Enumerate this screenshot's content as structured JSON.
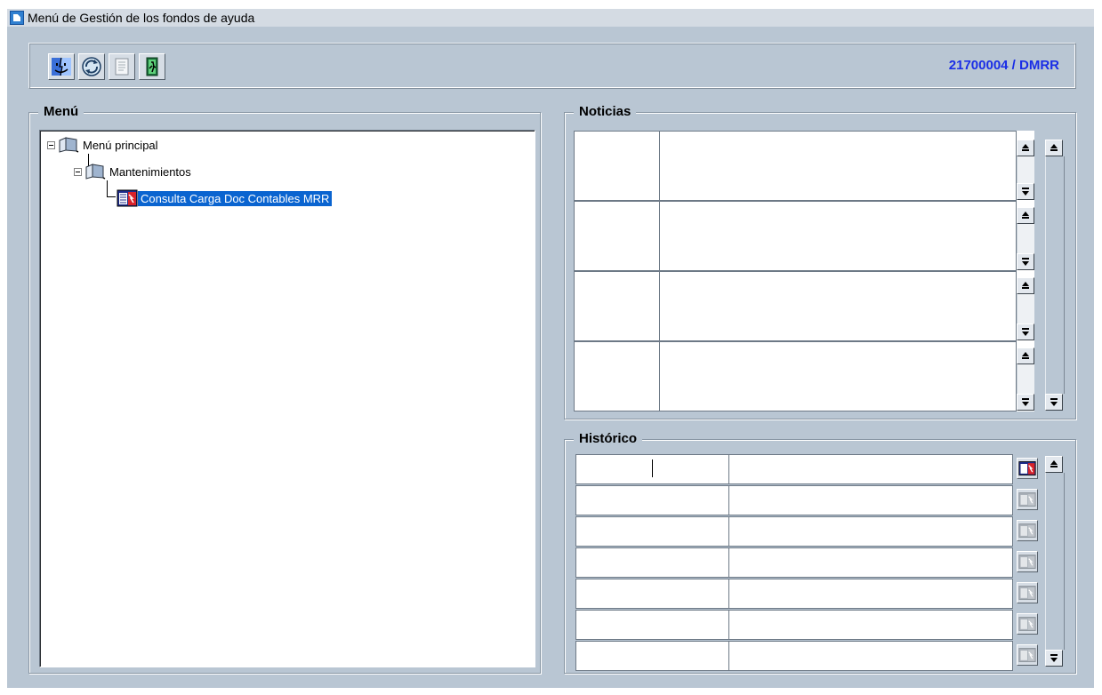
{
  "window": {
    "title": "Menú de Gestión de los fondos de ayuda"
  },
  "toolbar": {
    "buttons": [
      {
        "name": "finder-icon"
      },
      {
        "name": "refresh-icon"
      },
      {
        "name": "document-icon"
      },
      {
        "name": "exit-door-icon"
      }
    ],
    "user": "21700004 / DMRR"
  },
  "menu": {
    "title": "Menú",
    "tree": {
      "root": "Menú principal",
      "child": "Mantenimientos",
      "leaf": "Consulta Carga Doc Contables MRR"
    }
  },
  "noticias": {
    "title": "Noticias",
    "row_count": 4
  },
  "historico": {
    "title": "Histórico",
    "row_count": 7
  }
}
